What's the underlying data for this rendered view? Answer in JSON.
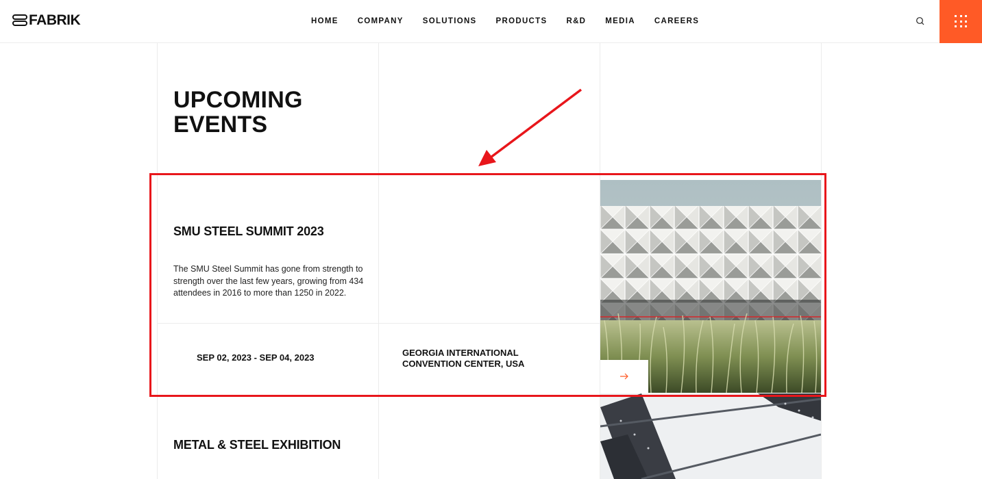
{
  "header": {
    "logo_text": "FABRIK",
    "nav": [
      "HOME",
      "COMPANY",
      "SOLUTIONS",
      "PRODUCTS",
      "R&D",
      "MEDIA",
      "CAREERS"
    ],
    "accent_color": "#ff5a26"
  },
  "section": {
    "title": "UPCOMING\nEVENTS"
  },
  "events": [
    {
      "title": "SMU STEEL SUMMIT 2023",
      "description": "The SMU Steel Summit has gone from strength to strength over the last few years, growing from 434 attendees in 2016 to more than 1250 in 2022.",
      "date": "SEP 02, 2023 - SEP 04, 2023",
      "venue": "GEORGIA INTERNATIONAL\nCONVENTION CENTER, USA",
      "image_icon": "white-geometric-facade-with-grass-photo"
    },
    {
      "title": "METAL & STEEL EXHIBITION",
      "image_icon": "steel-roof-structure-photo"
    }
  ],
  "annotation": {
    "color": "#e8161b",
    "icons": [
      "highlight-box",
      "pointer-arrow"
    ]
  }
}
